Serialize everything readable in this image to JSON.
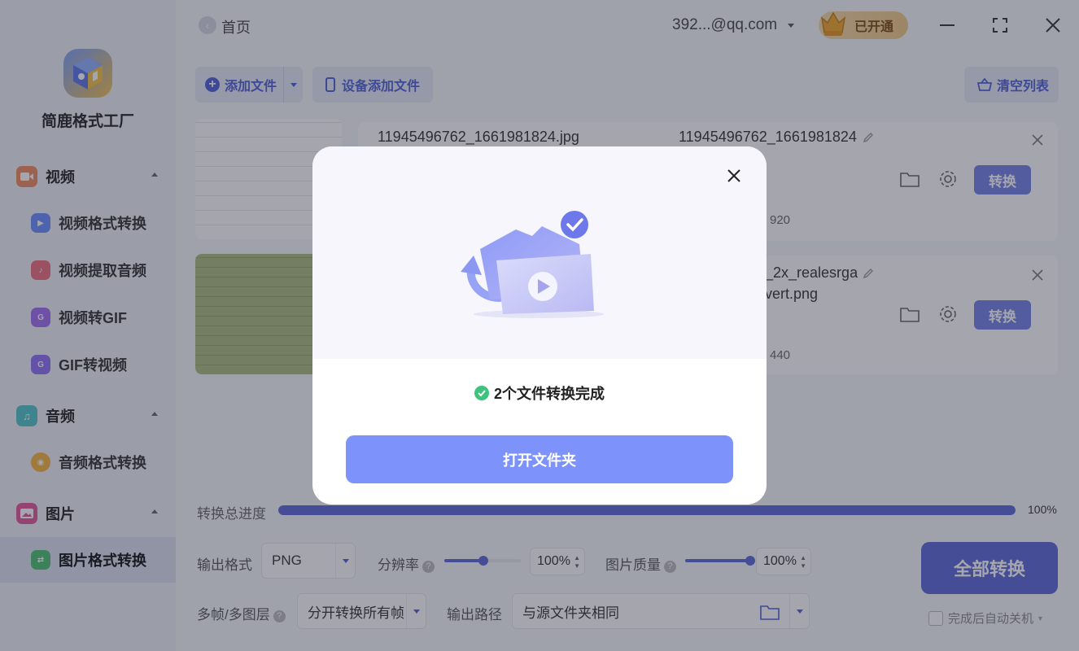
{
  "sidebar": {
    "app_name": "简鹿格式工厂",
    "groups": [
      {
        "label": "视频",
        "icon": "video-icon",
        "color": "#f08a5d"
      },
      {
        "label": "音频",
        "icon": "music-icon",
        "color": "#4fc3c9"
      },
      {
        "label": "图片",
        "icon": "image-icon",
        "color": "#e0569b"
      }
    ],
    "items": [
      {
        "label": "视频格式转换",
        "icon": "video-convert-icon",
        "color": "#6a8cff"
      },
      {
        "label": "视频提取音频",
        "icon": "audio-extract-icon",
        "color": "#ef6d7e"
      },
      {
        "label": "视频转GIF",
        "icon": "gif-icon",
        "color": "#a36bf5"
      },
      {
        "label": "GIF转视频",
        "icon": "gif-to-video-icon",
        "color": "#8e6ff7"
      },
      {
        "label": "音频格式转换",
        "icon": "audio-convert-icon",
        "color": "#f6b13f"
      },
      {
        "label": "图片格式转换",
        "icon": "image-convert-icon",
        "color": "#4dbf72",
        "active": true
      }
    ]
  },
  "topbar": {
    "home_label": "首页",
    "account": "392...@qq.com",
    "vip_label": "已开通"
  },
  "toolbar": {
    "add_file": "添加文件",
    "device_add": "设备添加文件",
    "clear_list": "清空列表"
  },
  "files": [
    {
      "name": "11945496762_1661981824.jpg",
      "output_name": "11945496762_1661981824",
      "dims": "920",
      "convert_label": "转换"
    },
    {
      "name": "",
      "output_name": "_2x_realesrga",
      "output_name_2": "vert.png",
      "dims": "440",
      "convert_label": "转换"
    }
  ],
  "progress": {
    "label": "转换总进度",
    "value_text": "100%",
    "value": 100
  },
  "settings": {
    "format_label": "输出格式",
    "format_value": "PNG",
    "resolution_label": "分辨率",
    "resolution_value": "100%",
    "quality_label": "图片质量",
    "quality_value": "100%",
    "frames_label": "多帧/多图层",
    "frames_value": "分开转换所有帧",
    "path_label": "输出路径",
    "path_value": "与源文件夹相同",
    "convert_all": "全部转换",
    "shutdown_label": "完成后自动关机"
  },
  "modal": {
    "message": "2个文件转换完成",
    "open_folder": "打开文件夹"
  },
  "colors": {
    "accent": "#5a67d8",
    "modal_button": "#7d93fb",
    "success": "#3cc47c"
  }
}
